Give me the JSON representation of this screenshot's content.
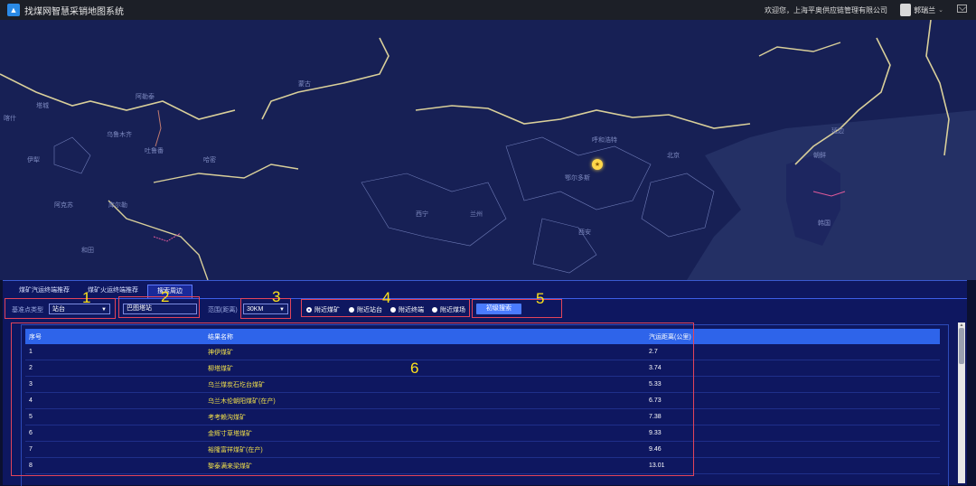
{
  "app": {
    "title": "找煤网智慧采销地图系统",
    "logo_glyph": "▲"
  },
  "header": {
    "welcome": "欢迎您，上海平奥供应链管理有限公司",
    "user": "郭瑞兰",
    "user_chevron": "⌄"
  },
  "map": {
    "labels": [
      "喀什",
      "塔城",
      "乌鲁木齐",
      "吐鲁番",
      "哈密",
      "阿勒泰",
      "蒙古",
      "鄂尔多斯",
      "北京",
      "朝鲜",
      "韩国",
      "延边",
      "呼和浩特",
      "西安",
      "兰州",
      "西宁",
      "伊犁",
      "库尔勒",
      "阿克苏",
      "和田"
    ],
    "marker_glyph": "★"
  },
  "tabs": [
    {
      "label": "煤矿汽运终端推荐",
      "active": false
    },
    {
      "label": "煤矿火运终端推荐",
      "active": false
    },
    {
      "label": "搜索周边",
      "active": true
    }
  ],
  "form": {
    "base_type_label": "基准点类型",
    "base_type_value": "站台",
    "station_value": "巴图塔站",
    "range_label": "范围(距离)",
    "range_value": "30KM",
    "radios": [
      {
        "label": "附近煤矿",
        "selected": true
      },
      {
        "label": "附近站台",
        "selected": false
      },
      {
        "label": "附近终端",
        "selected": false
      },
      {
        "label": "附近煤场",
        "selected": false
      }
    ],
    "search_button": "初级搜索",
    "dropdown_arrow": "▼"
  },
  "table": {
    "headers": [
      "序号",
      "结果名称",
      "汽运距离(公里)"
    ],
    "rows": [
      [
        "1",
        "神伊煤矿",
        "2.7"
      ],
      [
        "2",
        "柳塔煤矿",
        "3.74"
      ],
      [
        "3",
        "乌兰煤炭石圪台煤矿",
        "5.33"
      ],
      [
        "4",
        "乌兰木伦朝阳煤矿(在产)",
        "6.73"
      ],
      [
        "5",
        "考考赖沟煤矿",
        "7.38"
      ],
      [
        "6",
        "金辉寸草塔煤矿",
        "9.33"
      ],
      [
        "7",
        "裕隆富祥煤矿(在产)",
        "9.46"
      ],
      [
        "8",
        "黎泰满来梁煤矿",
        "13.01"
      ]
    ]
  },
  "annotations": [
    "1",
    "2",
    "3",
    "4",
    "5",
    "6"
  ],
  "colors": {
    "accent": "#2e64ea",
    "highlight_name": "#f2e14a",
    "annotation_box": "#e2445a",
    "annotation_number": "#ffe21a"
  }
}
